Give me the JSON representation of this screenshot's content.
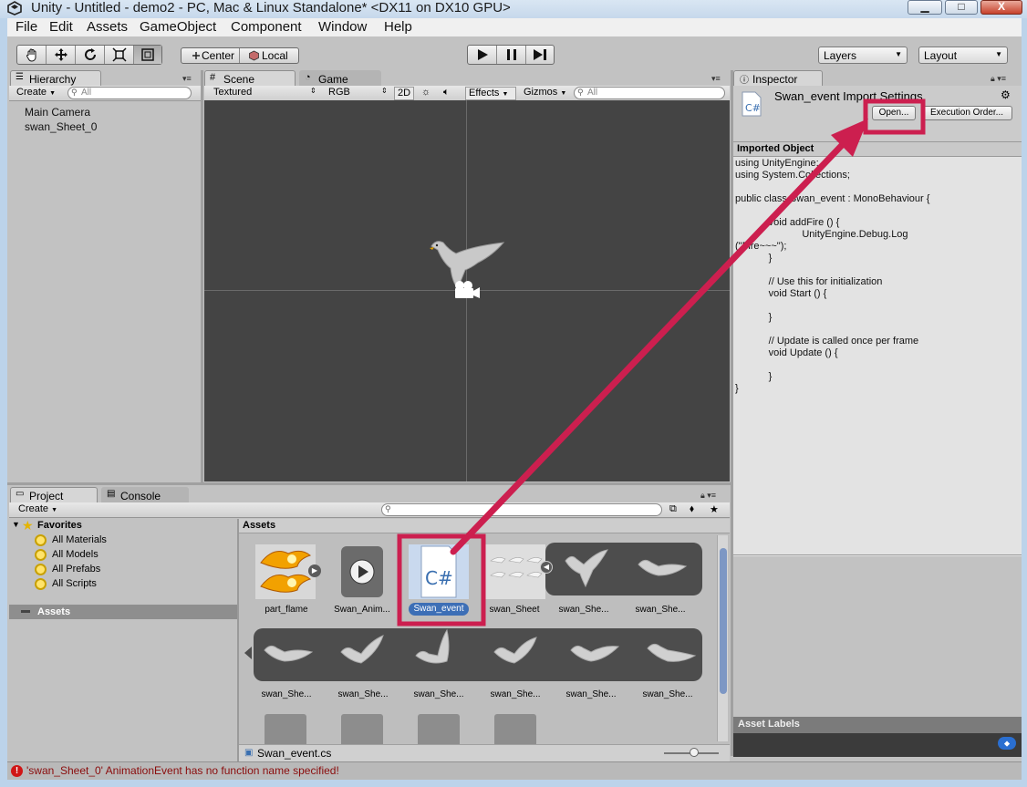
{
  "window": {
    "title": "Unity - Untitled - demo2 - PC, Mac & Linux Standalone* <DX11 on DX10 GPU>",
    "minimize_glyph": "▁",
    "maximize_glyph": "□",
    "close_glyph": "X"
  },
  "menu": [
    "File",
    "Edit",
    "Assets",
    "GameObject",
    "Component",
    "Window",
    "Help"
  ],
  "toolbar": {
    "tools": [
      "hand-tool",
      "move-tool",
      "rotate-tool",
      "scale-tool",
      "rect-tool"
    ],
    "pivot_label": "Center",
    "space_label": "Local",
    "play_glyph": "▶",
    "pause_glyph": "❚❚",
    "step_glyph": "▶|",
    "layers_label": "Layers",
    "layout_label": "Layout"
  },
  "hierarchy": {
    "tab_label": "Hierarchy",
    "create_label": "Create",
    "search_placeholder": "All",
    "items": [
      "Main Camera",
      "swan_Sheet_0"
    ]
  },
  "scene": {
    "tabs": [
      "Scene",
      "Game"
    ],
    "render_mode": "Textured",
    "color_mode": "RGB",
    "mode_2d": "2D",
    "effects_label": "Effects",
    "gizmos_label": "Gizmos",
    "search_placeholder": "All"
  },
  "inspector": {
    "tab_label": "Inspector",
    "title": "Swan_event Import Settings",
    "open_label": "Open...",
    "execution_order_label": "Execution Order...",
    "section_title": "Imported Object",
    "code_lines": [
      "using UnityEngine;",
      "using System.Collections;",
      "",
      "public class Swan_event : MonoBehaviour {",
      "",
      "            void addFire () {",
      "                        UnityEngine.Debug.Log",
      "(\"Fire~~~\");",
      "            }",
      "",
      "            // Use this for initialization",
      "            void Start () {",
      "",
      "            }",
      "",
      "            // Update is called once per frame",
      "            void Update () {",
      "",
      "            }",
      "}"
    ],
    "asset_labels_title": "Asset Labels"
  },
  "project": {
    "tabs": [
      "Project",
      "Console"
    ],
    "create_label": "Create",
    "favorites_label": "Favorites",
    "favorites": [
      "All Materials",
      "All Models",
      "All Prefabs",
      "All Scripts"
    ],
    "assets_folder_label": "Assets",
    "assets_header": "Assets",
    "row1": [
      "part_flame",
      "Swan_Anim...",
      "Swan_event",
      "swan_Sheet",
      "swan_She...",
      "swan_She..."
    ],
    "row2": [
      "swan_She...",
      "swan_She...",
      "swan_She...",
      "swan_She...",
      "swan_She...",
      "swan_She..."
    ],
    "selected_path": "Swan_event.cs",
    "script_glyph": "C#"
  },
  "status": {
    "message": "'swan_Sheet_0' AnimationEvent has no function name specified!",
    "error_glyph": "!"
  },
  "colors": {
    "annotation": "#cc1f4f",
    "selection": "#3d6fb6"
  }
}
